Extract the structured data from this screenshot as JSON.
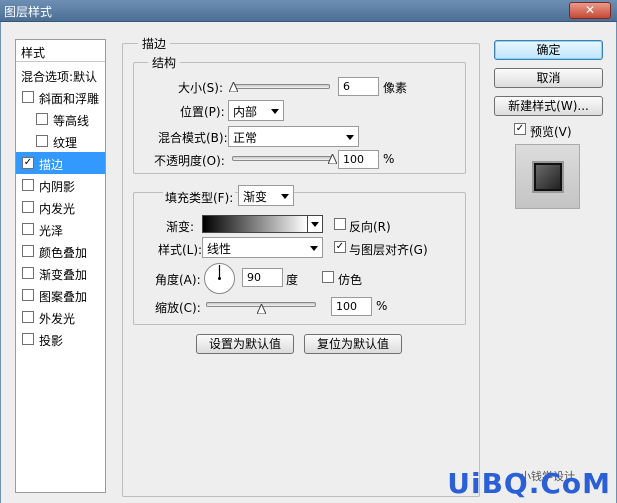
{
  "window": {
    "title": "图层样式",
    "close": "✕"
  },
  "sidebar": {
    "header": "样式",
    "items": [
      {
        "label": "混合选项:默认",
        "checkbox": false,
        "checked": false,
        "indent": 0,
        "selected": false
      },
      {
        "label": "斜面和浮雕",
        "checkbox": true,
        "checked": false,
        "indent": 0,
        "selected": false
      },
      {
        "label": "等高线",
        "checkbox": true,
        "checked": false,
        "indent": 1,
        "selected": false
      },
      {
        "label": "纹理",
        "checkbox": true,
        "checked": false,
        "indent": 1,
        "selected": false
      },
      {
        "label": "描边",
        "checkbox": true,
        "checked": true,
        "indent": 0,
        "selected": true
      },
      {
        "label": "内阴影",
        "checkbox": true,
        "checked": false,
        "indent": 0,
        "selected": false
      },
      {
        "label": "内发光",
        "checkbox": true,
        "checked": false,
        "indent": 0,
        "selected": false
      },
      {
        "label": "光泽",
        "checkbox": true,
        "checked": false,
        "indent": 0,
        "selected": false
      },
      {
        "label": "颜色叠加",
        "checkbox": true,
        "checked": false,
        "indent": 0,
        "selected": false
      },
      {
        "label": "渐变叠加",
        "checkbox": true,
        "checked": false,
        "indent": 0,
        "selected": false
      },
      {
        "label": "图案叠加",
        "checkbox": true,
        "checked": false,
        "indent": 0,
        "selected": false
      },
      {
        "label": "外发光",
        "checkbox": true,
        "checked": false,
        "indent": 0,
        "selected": false
      },
      {
        "label": "投影",
        "checkbox": true,
        "checked": false,
        "indent": 0,
        "selected": false
      }
    ]
  },
  "stroke": {
    "title": "描边",
    "structure": {
      "title": "结构",
      "size_label": "大小(S):",
      "size_value": "6",
      "size_unit": "像素",
      "size_slider": 0.02,
      "position_label": "位置(P):",
      "position_value": "内部",
      "blend_label": "混合模式(B):",
      "blend_value": "正常",
      "opacity_label": "不透明度(O):",
      "opacity_value": "100",
      "opacity_unit": "%",
      "opacity_slider": 1.0
    },
    "fill": {
      "type_label": "填充类型(F):",
      "type_value": "渐变",
      "gradient_label": "渐变:",
      "reverse_label": "反向(R)",
      "reverse_checked": false,
      "style_label": "样式(L):",
      "style_value": "线性",
      "align_label": "与图层对齐(G)",
      "align_checked": true,
      "angle_label": "角度(A):",
      "angle_value": "90",
      "angle_unit": "度",
      "dither_label": "仿色",
      "dither_checked": false,
      "scale_label": "缩放(C):",
      "scale_value": "100",
      "scale_unit": "%",
      "scale_slider": 0.5
    },
    "make_default": "设置为默认值",
    "reset_default": "复位为默认值"
  },
  "buttons": {
    "ok": "确定",
    "cancel": "取消",
    "new_style": "新建样式(W)...",
    "preview_label": "预览(V)",
    "preview_checked": true
  },
  "watermark": {
    "small": "小钱学设计",
    "brand": "UiBQ.CoM"
  },
  "colors": {
    "selected": "#3399ff",
    "titlebar": "#5c7fa5",
    "watermark": "#2b5fd6"
  }
}
